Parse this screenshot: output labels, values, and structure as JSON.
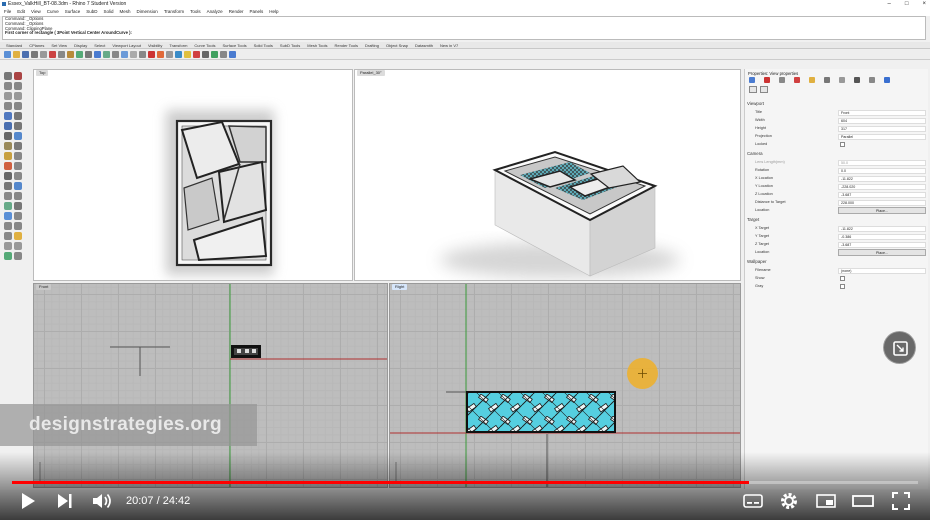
{
  "app": {
    "title": "Essex_ValkHill_BT-08.3dm - Rhino 7 Student Version",
    "window_controls": [
      "–",
      "□",
      "×"
    ]
  },
  "menu": [
    "File",
    "Edit",
    "View",
    "Curve",
    "Surface",
    "SubD",
    "Solid",
    "Mesh",
    "Dimension",
    "Transform",
    "Tools",
    "Analyze",
    "Render",
    "Panels",
    "Help"
  ],
  "command_history": [
    "Command: _Options",
    "Command: _Options",
    "Command: ClippingPlane",
    "First corner of rectangle ( 3Point  Vertical  Center  AroundCurve ):"
  ],
  "toolbar_tabs": [
    "Standard",
    "CPlanes",
    "Set View",
    "Display",
    "Select",
    "Viewport Layout",
    "Visibility",
    "Transform",
    "Curve Tools",
    "Surface Tools",
    "Solid Tools",
    "SubD Tools",
    "Mesh Tools",
    "Render Tools",
    "Drafting",
    "Object Snap",
    "Datasmith",
    "New in V7"
  ],
  "viewports": {
    "top": "Top",
    "perspective": "Parallel_30°",
    "front": "Front",
    "right": "Right"
  },
  "properties": {
    "title": "Properties: View properties",
    "sections": {
      "viewport": "Viewport",
      "camera": "Camera",
      "target": "Target",
      "wallpaper": "Wallpaper"
    },
    "viewport_rows": [
      {
        "key": "Title",
        "value": "Front"
      },
      {
        "key": "Width",
        "value": "604"
      },
      {
        "key": "Height",
        "value": "317"
      },
      {
        "key": "Projection",
        "value": "Parallel"
      },
      {
        "key": "Locked",
        "value": ""
      }
    ],
    "camera_rows": [
      {
        "key": "Lens Length(mm)",
        "value": "50.0"
      },
      {
        "key": "Rotation",
        "value": "0.0"
      },
      {
        "key": "X Location",
        "value": "-11.822"
      },
      {
        "key": "Y Location",
        "value": "-228.020"
      },
      {
        "key": "Z Location",
        "value": "-3.687"
      },
      {
        "key": "Distance to Target",
        "value": "228.000"
      },
      {
        "key": "Location",
        "value": "Place..."
      }
    ],
    "target_rows": [
      {
        "key": "X Target",
        "value": "-11.822"
      },
      {
        "key": "Y Target",
        "value": "-0.386"
      },
      {
        "key": "Z Target",
        "value": "-3.687"
      },
      {
        "key": "Location",
        "value": "Place..."
      }
    ],
    "wallpaper_rows": [
      {
        "key": "Filename",
        "value": "(none)"
      },
      {
        "key": "Show",
        "value": ""
      },
      {
        "key": "Gray",
        "value": ""
      }
    ]
  },
  "watermark": "designstrategies.org",
  "video": {
    "current_time": "20:07",
    "duration": "24:42",
    "time_display": "20:07 / 24:42",
    "progress": 0.814
  },
  "colors": {
    "progress": "#ff0000",
    "cursor_highlight": "#f0b028",
    "hatch_cyan": "#55cfe0"
  }
}
